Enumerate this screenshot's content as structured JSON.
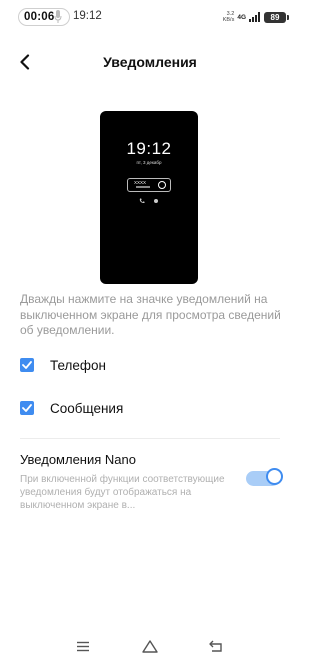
{
  "status_bar": {
    "call_timer": "00:06",
    "clock": "19:12",
    "speed_value": "3.2",
    "speed_unit": "KB/s",
    "network": "4G",
    "battery": "89"
  },
  "header": {
    "title": "Уведомления"
  },
  "preview": {
    "time": "19:12",
    "date": "пт, 3 декабр",
    "notification_text": "XXXX"
  },
  "description": "Дважды нажмите на значке уведомлений на выключенном экране для просмотра сведений об уведомлении.",
  "options": [
    {
      "label": "Телефон",
      "checked": true
    },
    {
      "label": "Сообщения",
      "checked": true
    }
  ],
  "nano": {
    "title": "Уведомления Nano",
    "description": "При включенной функции соответствующие уведомления будут отображаться на выключенном экране в...",
    "enabled": true
  },
  "colors": {
    "accent": "#3f8cf0",
    "toggle_track": "#a9cdf7"
  },
  "icons": {
    "back": "back-arrow-icon",
    "menu": "menu-icon",
    "home": "home-icon",
    "back_nav": "return-icon"
  }
}
